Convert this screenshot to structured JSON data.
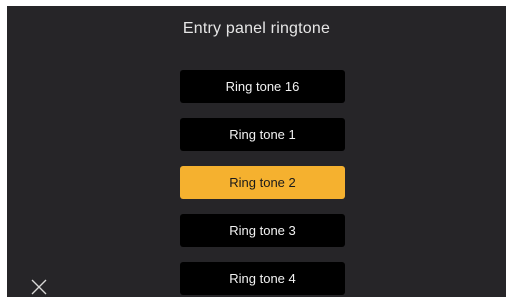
{
  "header": {
    "title": "Entry panel ringtone"
  },
  "ringtones": {
    "items": [
      {
        "label": "Ring tone 16",
        "selected": false
      },
      {
        "label": "Ring tone 1",
        "selected": false
      },
      {
        "label": "Ring tone 2",
        "selected": true
      },
      {
        "label": "Ring tone 3",
        "selected": false
      },
      {
        "label": "Ring tone 4",
        "selected": false
      }
    ]
  },
  "colors": {
    "background": "#262528",
    "item_background": "#000000",
    "selected_accent": "#f5b12f",
    "text": "#f2f2f2"
  },
  "icons": {
    "close": "close-icon"
  }
}
